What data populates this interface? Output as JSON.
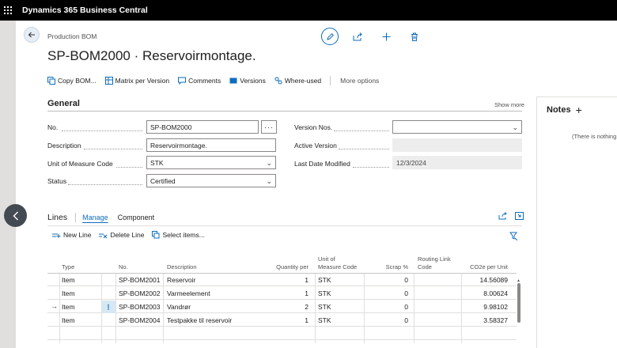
{
  "app": {
    "title": "Dynamics 365 Business Central"
  },
  "page": {
    "breadcrumb": "Production BOM",
    "title": "SP-BOM2000 · Reservoirmontage."
  },
  "actions": [
    "Copy BOM...",
    "Matrix per Version",
    "Comments",
    "Versions",
    "Where-used"
  ],
  "more_options": "More options",
  "general": {
    "title": "General",
    "show_more": "Show more",
    "no_label": "No.",
    "no_value": "SP-BOM2000",
    "description_label": "Description",
    "description_value": "Reservoirmontage.",
    "uom_label": "Unit of Measure Code",
    "uom_value": "STK",
    "status_label": "Status",
    "status_value": "Certified",
    "version_nos_label": "Version Nos.",
    "version_nos_value": "",
    "active_version_label": "Active Version",
    "active_version_value": "",
    "last_modified_label": "Last Date Modified",
    "last_modified_value": "12/3/2024",
    "assist_glyph": "···"
  },
  "notes": {
    "title": "Notes",
    "plus": "+",
    "empty_text": "(There is nothing t"
  },
  "lines": {
    "title": "Lines",
    "tabs": [
      "Manage",
      "Component"
    ],
    "actions": [
      "New Line",
      "Delete Line",
      "Select items..."
    ],
    "columns": {
      "type": "Type",
      "no": "No.",
      "description": "Description",
      "qty": "Quantity per",
      "uom_1": "Unit of",
      "uom_2": "Measure Code",
      "scrap": "Scrap %",
      "routing_1": "Routing Link",
      "routing_2": "Code",
      "co2e": "CO2e per Unit"
    },
    "rows": [
      {
        "type": "Item",
        "no": "SP-BOM2001",
        "description": "Reservoir",
        "qty": "1",
        "uom": "STK",
        "scrap": "0",
        "routing": "",
        "co2e": "14.56089"
      },
      {
        "type": "Item",
        "no": "SP-BOM2002",
        "description": "Varmeelement",
        "qty": "1",
        "uom": "STK",
        "scrap": "0",
        "routing": "",
        "co2e": "8.00624"
      },
      {
        "type": "Item",
        "no": "SP-BOM2003",
        "description": "Vandrør",
        "qty": "2",
        "uom": "STK",
        "scrap": "0",
        "routing": "",
        "co2e": "9.98102"
      },
      {
        "type": "Item",
        "no": "SP-BOM2004",
        "description": "Testpakke til reservoir",
        "qty": "1",
        "uom": "STK",
        "scrap": "0",
        "routing": "",
        "co2e": "3.58327"
      }
    ],
    "active_row_marker": "→",
    "row_menu_glyph": "⋮"
  },
  "colors": {
    "accent": "#0f6cbd",
    "topbar": "#000000"
  }
}
